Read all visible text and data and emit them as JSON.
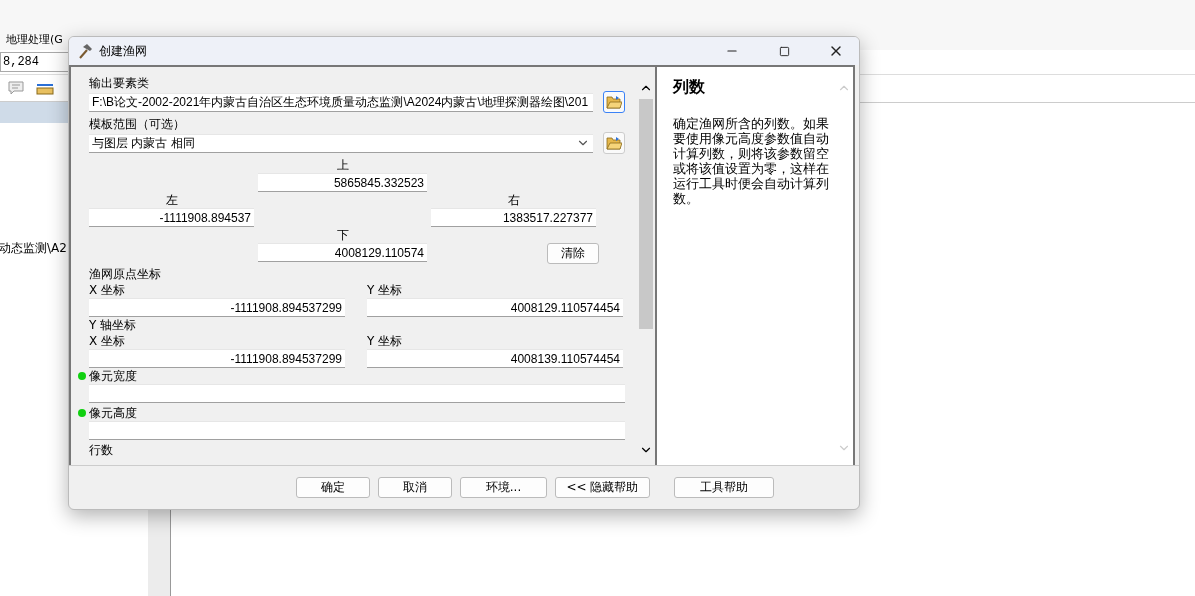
{
  "background_app": {
    "menu": [
      {
        "label": "地理处理(G"
      }
    ],
    "scale_field": {
      "value": "8,284"
    },
    "tree_text": "动态监测\\A2"
  },
  "dialog": {
    "title": "创建渔网",
    "params": [
      {
        "kind": "path",
        "label": "输出要素类",
        "value": "F:\\B论文-2002-2021年内蒙古自治区生态环境质量动态监测\\A2024内蒙古\\地理探测器绘图\\201"
      },
      {
        "kind": "extent",
        "label": "模板范围（可选）",
        "value": "与图层 内蒙古 相同",
        "top": {
          "label": "上",
          "value": "5865845.332523"
        },
        "left": {
          "label": "左",
          "value": "-1111908.894537"
        },
        "right": {
          "label": "右",
          "value": "1383517.227377"
        },
        "bottom": {
          "label": "下",
          "value": "4008129.110574"
        },
        "clear_button": "清除"
      },
      {
        "kind": "point",
        "label": "渔网原点坐标",
        "x": {
          "label": "X 坐标",
          "value": "-1111908.894537299"
        },
        "y": {
          "label": "Y 坐标",
          "value": "4008129.110574454"
        }
      },
      {
        "kind": "point",
        "label": "Y 轴坐标",
        "x": {
          "label": "X 坐标",
          "value": "-1111908.894537299"
        },
        "y": {
          "label": "Y 坐标",
          "value": "4008139.110574454"
        }
      },
      {
        "kind": "number",
        "label": "像元宽度",
        "required": true
      },
      {
        "kind": "number",
        "label": "像元高度",
        "required": true
      },
      {
        "kind": "heading",
        "label": "行数"
      }
    ],
    "help": {
      "title": "列数",
      "body": "确定渔网所含的列数。如果要使用像元高度参数值自动计算列数，则将该参数留空或将该值设置为零，这样在运行工具时便会自动计算列数。"
    },
    "buttons": [
      {
        "label": "确定",
        "kind": "main"
      },
      {
        "label": "取消",
        "kind": "main"
      },
      {
        "label": "环境...",
        "kind": "main"
      },
      {
        "label": "<< 隐藏帮助",
        "kind": "main"
      },
      {
        "label": "工具帮助",
        "kind": "side"
      }
    ]
  }
}
